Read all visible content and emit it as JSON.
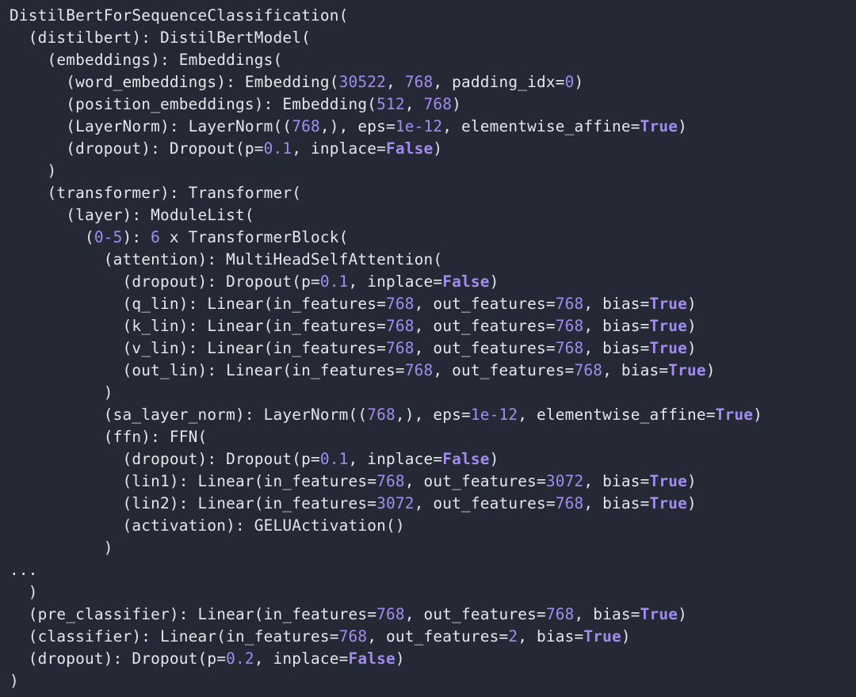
{
  "meta": {
    "description": "PyTorch module repr() output for a DistilBERT sequence classification model, rendered with syntax-highlighted numbers and booleans.",
    "font": "monospace",
    "background_color": "#242935",
    "text_color": "#e6e7eb",
    "number_color": "#a28cf0",
    "boolean_color": "#a28cf0"
  },
  "model": {
    "class": "DistilBertForSequenceClassification",
    "distilbert": {
      "class": "DistilBertModel",
      "embeddings": {
        "class": "Embeddings",
        "word_embeddings": {
          "class": "Embedding",
          "num_embeddings": 30522,
          "embedding_dim": 768,
          "padding_idx": 0
        },
        "position_embeddings": {
          "class": "Embedding",
          "num_embeddings": 512,
          "embedding_dim": 768
        },
        "LayerNorm": {
          "class": "LayerNorm",
          "normalized_shape": [
            768
          ],
          "eps": "1e-12",
          "elementwise_affine": true
        },
        "dropout": {
          "class": "Dropout",
          "p": 0.1,
          "inplace": false
        }
      },
      "transformer": {
        "class": "Transformer",
        "layer": {
          "class": "ModuleList",
          "range": "0-5",
          "count": 6,
          "block_class": "TransformerBlock",
          "block": {
            "attention": {
              "class": "MultiHeadSelfAttention",
              "dropout": {
                "class": "Dropout",
                "p": 0.1,
                "inplace": false
              },
              "q_lin": {
                "class": "Linear",
                "in_features": 768,
                "out_features": 768,
                "bias": true
              },
              "k_lin": {
                "class": "Linear",
                "in_features": 768,
                "out_features": 768,
                "bias": true
              },
              "v_lin": {
                "class": "Linear",
                "in_features": 768,
                "out_features": 768,
                "bias": true
              },
              "out_lin": {
                "class": "Linear",
                "in_features": 768,
                "out_features": 768,
                "bias": true
              }
            },
            "sa_layer_norm": {
              "class": "LayerNorm",
              "normalized_shape": [
                768
              ],
              "eps": "1e-12",
              "elementwise_affine": true
            },
            "ffn": {
              "class": "FFN",
              "dropout": {
                "class": "Dropout",
                "p": 0.1,
                "inplace": false
              },
              "lin1": {
                "class": "Linear",
                "in_features": 768,
                "out_features": 3072,
                "bias": true
              },
              "lin2": {
                "class": "Linear",
                "in_features": 3072,
                "out_features": 768,
                "bias": true
              },
              "activation": {
                "class": "GELUActivation"
              }
            }
          }
        }
      }
    },
    "truncated": true,
    "pre_classifier": {
      "class": "Linear",
      "in_features": 768,
      "out_features": 768,
      "bias": true
    },
    "classifier": {
      "class": "Linear",
      "in_features": 768,
      "out_features": 2,
      "bias": true
    },
    "dropout": {
      "class": "Dropout",
      "p": 0.2,
      "inplace": false
    }
  },
  "lines": [
    [
      [
        "txt",
        "DistilBertForSequenceClassification("
      ]
    ],
    [
      [
        "txt",
        "  (distilbert): DistilBertModel("
      ]
    ],
    [
      [
        "txt",
        "    (embeddings): Embeddings("
      ]
    ],
    [
      [
        "txt",
        "      (word_embeddings): Embedding("
      ],
      [
        "num",
        "30522"
      ],
      [
        "txt",
        ", "
      ],
      [
        "num",
        "768"
      ],
      [
        "txt",
        ", padding_idx="
      ],
      [
        "num",
        "0"
      ],
      [
        "txt",
        ")"
      ]
    ],
    [
      [
        "txt",
        "      (position_embeddings): Embedding("
      ],
      [
        "num",
        "512"
      ],
      [
        "txt",
        ", "
      ],
      [
        "num",
        "768"
      ],
      [
        "txt",
        ")"
      ]
    ],
    [
      [
        "txt",
        "      (LayerNorm): LayerNorm(("
      ],
      [
        "num",
        "768"
      ],
      [
        "txt",
        ",), eps="
      ],
      [
        "num",
        "1e-12"
      ],
      [
        "txt",
        ", elementwise_affine="
      ],
      [
        "bool",
        "True"
      ],
      [
        "txt",
        ")"
      ]
    ],
    [
      [
        "txt",
        "      (dropout): Dropout(p="
      ],
      [
        "num",
        "0.1"
      ],
      [
        "txt",
        ", inplace="
      ],
      [
        "bool",
        "False"
      ],
      [
        "txt",
        ")"
      ]
    ],
    [
      [
        "txt",
        "    )"
      ]
    ],
    [
      [
        "txt",
        "    (transformer): Transformer("
      ]
    ],
    [
      [
        "txt",
        "      (layer): ModuleList("
      ]
    ],
    [
      [
        "txt",
        "        ("
      ],
      [
        "num",
        "0-5"
      ],
      [
        "txt",
        "): "
      ],
      [
        "num",
        "6"
      ],
      [
        "txt",
        " x TransformerBlock("
      ]
    ],
    [
      [
        "txt",
        "          (attention): MultiHeadSelfAttention("
      ]
    ],
    [
      [
        "txt",
        "            (dropout): Dropout(p="
      ],
      [
        "num",
        "0.1"
      ],
      [
        "txt",
        ", inplace="
      ],
      [
        "bool",
        "False"
      ],
      [
        "txt",
        ")"
      ]
    ],
    [
      [
        "txt",
        "            (q_lin): Linear(in_features="
      ],
      [
        "num",
        "768"
      ],
      [
        "txt",
        ", out_features="
      ],
      [
        "num",
        "768"
      ],
      [
        "txt",
        ", bias="
      ],
      [
        "bool",
        "True"
      ],
      [
        "txt",
        ")"
      ]
    ],
    [
      [
        "txt",
        "            (k_lin): Linear(in_features="
      ],
      [
        "num",
        "768"
      ],
      [
        "txt",
        ", out_features="
      ],
      [
        "num",
        "768"
      ],
      [
        "txt",
        ", bias="
      ],
      [
        "bool",
        "True"
      ],
      [
        "txt",
        ")"
      ]
    ],
    [
      [
        "txt",
        "            (v_lin): Linear(in_features="
      ],
      [
        "num",
        "768"
      ],
      [
        "txt",
        ", out_features="
      ],
      [
        "num",
        "768"
      ],
      [
        "txt",
        ", bias="
      ],
      [
        "bool",
        "True"
      ],
      [
        "txt",
        ")"
      ]
    ],
    [
      [
        "txt",
        "            (out_lin): Linear(in_features="
      ],
      [
        "num",
        "768"
      ],
      [
        "txt",
        ", out_features="
      ],
      [
        "num",
        "768"
      ],
      [
        "txt",
        ", bias="
      ],
      [
        "bool",
        "True"
      ],
      [
        "txt",
        ")"
      ]
    ],
    [
      [
        "txt",
        "          )"
      ]
    ],
    [
      [
        "txt",
        "          (sa_layer_norm): LayerNorm(("
      ],
      [
        "num",
        "768"
      ],
      [
        "txt",
        ",), eps="
      ],
      [
        "num",
        "1e-12"
      ],
      [
        "txt",
        ", elementwise_affine="
      ],
      [
        "bool",
        "True"
      ],
      [
        "txt",
        ")"
      ]
    ],
    [
      [
        "txt",
        "          (ffn): FFN("
      ]
    ],
    [
      [
        "txt",
        "            (dropout): Dropout(p="
      ],
      [
        "num",
        "0.1"
      ],
      [
        "txt",
        ", inplace="
      ],
      [
        "bool",
        "False"
      ],
      [
        "txt",
        ")"
      ]
    ],
    [
      [
        "txt",
        "            (lin1): Linear(in_features="
      ],
      [
        "num",
        "768"
      ],
      [
        "txt",
        ", out_features="
      ],
      [
        "num",
        "3072"
      ],
      [
        "txt",
        ", bias="
      ],
      [
        "bool",
        "True"
      ],
      [
        "txt",
        ")"
      ]
    ],
    [
      [
        "txt",
        "            (lin2): Linear(in_features="
      ],
      [
        "num",
        "3072"
      ],
      [
        "txt",
        ", out_features="
      ],
      [
        "num",
        "768"
      ],
      [
        "txt",
        ", bias="
      ],
      [
        "bool",
        "True"
      ],
      [
        "txt",
        ")"
      ]
    ],
    [
      [
        "txt",
        "            (activation): GELUActivation()"
      ]
    ],
    [
      [
        "txt",
        "          )"
      ]
    ],
    [
      [
        "txt",
        "..."
      ]
    ],
    [
      [
        "txt",
        "  )"
      ]
    ],
    [
      [
        "txt",
        "  (pre_classifier): Linear(in_features="
      ],
      [
        "num",
        "768"
      ],
      [
        "txt",
        ", out_features="
      ],
      [
        "num",
        "768"
      ],
      [
        "txt",
        ", bias="
      ],
      [
        "bool",
        "True"
      ],
      [
        "txt",
        ")"
      ]
    ],
    [
      [
        "txt",
        "  (classifier): Linear(in_features="
      ],
      [
        "num",
        "768"
      ],
      [
        "txt",
        ", out_features="
      ],
      [
        "num",
        "2"
      ],
      [
        "txt",
        ", bias="
      ],
      [
        "bool",
        "True"
      ],
      [
        "txt",
        ")"
      ]
    ],
    [
      [
        "txt",
        "  (dropout): Dropout(p="
      ],
      [
        "num",
        "0.2"
      ],
      [
        "txt",
        ", inplace="
      ],
      [
        "bool",
        "False"
      ],
      [
        "txt",
        ")"
      ]
    ],
    [
      [
        "txt",
        ")"
      ]
    ]
  ]
}
